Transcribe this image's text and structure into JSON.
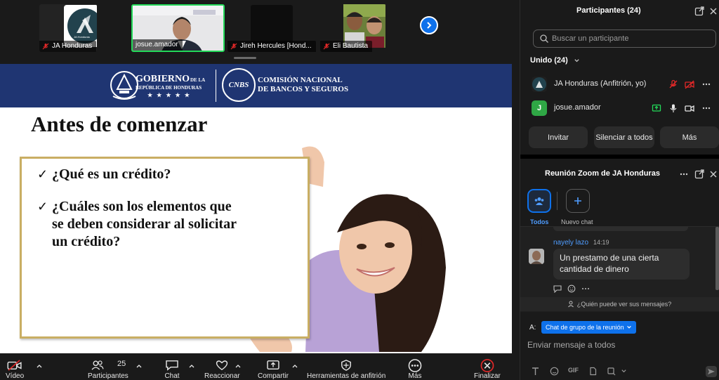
{
  "video_strip": {
    "tiles": [
      {
        "name": "JA Honduras",
        "logo_caption": "JA Honduras"
      },
      {
        "name": "josue.amador"
      },
      {
        "name": "Jireh Hercules [Hond..."
      },
      {
        "name": "Eli Bautista"
      }
    ]
  },
  "slide": {
    "banner": {
      "gobierno_line1": "GOBIERNO",
      "gobierno_de_la": "DE LA",
      "gobierno_line2": "REPÚBLICA DE HONDURAS",
      "stars": "★ ★ ★ ★ ★",
      "cnbs_line1": "COMISIÓN NACIONAL",
      "cnbs_line2": "DE BANCOS Y SEGUROS",
      "cnbs_emblem_text": "CNBS"
    },
    "title": "Antes de comenzar",
    "bullets": [
      {
        "check": "✓",
        "lines": [
          "¿Qué es un crédito?"
        ]
      },
      {
        "check": "✓",
        "lines": [
          "¿Cuáles son los elementos que",
          "se deben considerar al solicitar",
          "un crédito?"
        ]
      }
    ]
  },
  "toolbar": {
    "video_label": "Vídeo",
    "participants_label": "Participantes",
    "participants_count": "25",
    "chat_label": "Chat",
    "react_label": "Reaccionar",
    "share_label": "Compartir",
    "host_tools_label": "Herramientas de anfitrión",
    "more_label": "Más",
    "end_label": "Finalizar"
  },
  "participants_panel": {
    "title": "Participantes (24)",
    "search_placeholder": "Buscar un participante",
    "section_label": "Unido (24)",
    "rows": [
      {
        "avatar_letter": "",
        "name": "JA Honduras (Anfitrión, yo)"
      },
      {
        "avatar_letter": "J",
        "name": "josue.amador"
      }
    ],
    "buttons": {
      "invite": "Invitar",
      "mute_all": "Silenciar a todos",
      "more": "Más"
    }
  },
  "chat_panel": {
    "title": "Reunión Zoom de JA Honduras",
    "tabs": {
      "all_label": "Todos",
      "new_chat_label": "Nuevo chat"
    },
    "message": {
      "sender": "nayely lazo",
      "time": "14:19",
      "text_line1": "Un prestamo de una cierta",
      "text_line2": "cantidad de dinero"
    },
    "who_can_see": "¿Quién puede ver sus mensajes?",
    "to_label": "A:",
    "to_value": "Chat de grupo de la reunión",
    "input_placeholder": "Enviar mensaje a todos",
    "gif_label": "GIF"
  },
  "colors": {
    "zoom_blue": "#0e71eb",
    "slide_banner": "#1f3572",
    "box_border": "#c9ae63",
    "mute_red": "#e02828",
    "unmuted_green": "#23d959",
    "end_red": "#e02828"
  },
  "icons": {
    "next_page": "chevron-right-icon",
    "video_off": "video-off-icon",
    "participants": "people-icon",
    "chat": "speech-bubble-icon",
    "react": "heart-icon",
    "share": "share-screen-icon",
    "host_tools": "shield-icon",
    "more": "ellipsis-circle-icon",
    "end": "close-circle-icon"
  }
}
